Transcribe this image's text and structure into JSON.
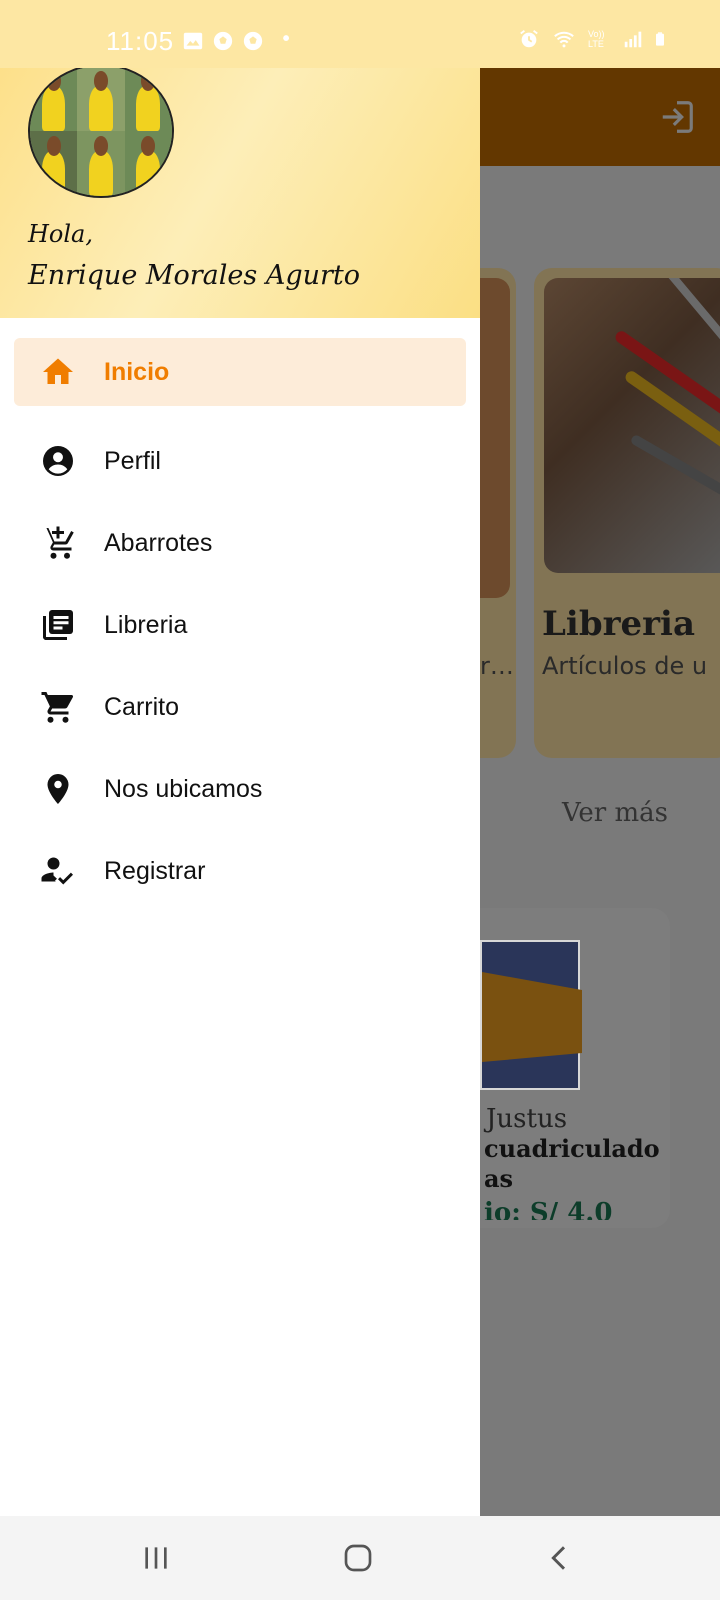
{
  "status_bar": {
    "time": "11:05",
    "icons_left": [
      "gallery-icon",
      "soccer-ball-icon",
      "soccer-ball-icon",
      "dot-icon"
    ],
    "icons_right": [
      "alarm-icon",
      "wifi-icon",
      "volte-icon",
      "signal-icon",
      "battery-icon"
    ],
    "volte_label": "Vo)) LTE"
  },
  "drawer": {
    "greeting": "Hola,",
    "user_name": "Enrique Morales Agurto",
    "menu": [
      {
        "label": "Inicio",
        "icon": "home-icon",
        "active": true
      },
      {
        "label": "Perfil",
        "icon": "account-circle-icon",
        "active": false
      },
      {
        "label": "Abarrotes",
        "icon": "add-shopping-cart-icon",
        "active": false
      },
      {
        "label": "Libreria",
        "icon": "library-books-icon",
        "active": false
      },
      {
        "label": "Carrito",
        "icon": "shopping-cart-icon",
        "active": false
      },
      {
        "label": "Nos ubicamos",
        "icon": "location-pin-icon",
        "active": false
      },
      {
        "label": "Registrar",
        "icon": "how-to-reg-icon",
        "active": false
      }
    ],
    "accent_color": "#f07d00",
    "active_bg": "#fdecd9"
  },
  "background_app": {
    "appbar_icon": "logout-icon",
    "category_partial_sub": "r…",
    "category_title": "Libreria",
    "category_sub": "Artículos de u",
    "see_more": "Ver más",
    "product_brand": "Justus",
    "product_name_line1": "cuadriculado",
    "product_name_line2": "as",
    "product_price": "io: S/ 4.0"
  },
  "nav_bar": {
    "buttons": [
      "recent-apps-icon",
      "home-button-icon",
      "back-icon"
    ]
  }
}
